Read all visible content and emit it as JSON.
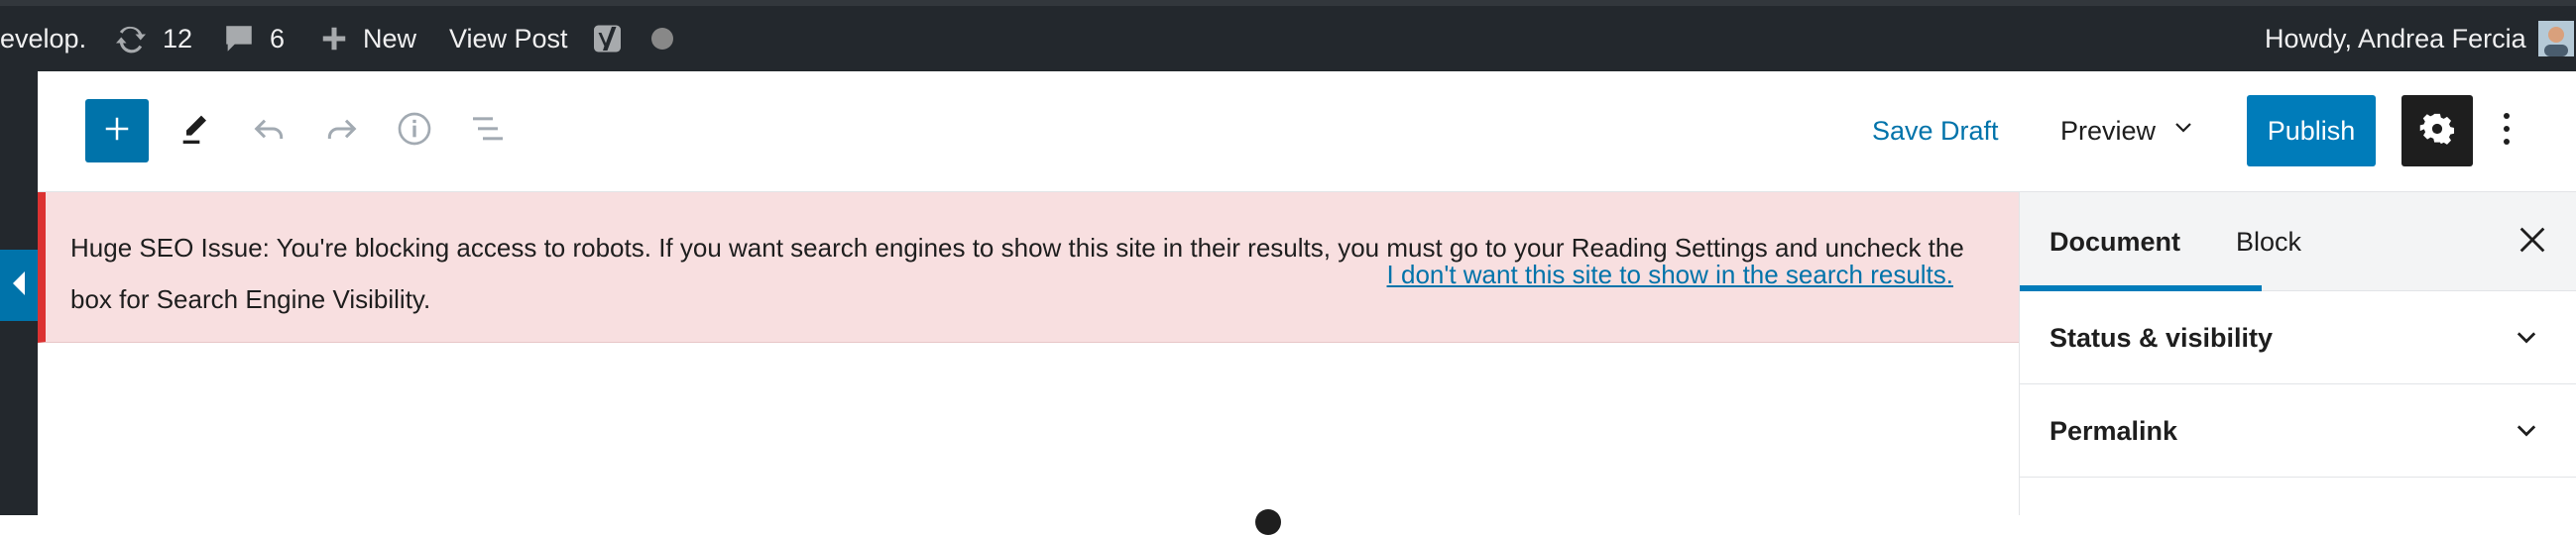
{
  "admin_bar": {
    "site_name": "evelop.",
    "updates_count": "12",
    "comments_count": "6",
    "new_label": "New",
    "view_post_label": "View Post",
    "greeting": "Howdy, Andrea Fercia",
    "icons": [
      "updates-icon",
      "comments-icon",
      "plus-icon",
      "yoast-icon",
      "status-dot-icon",
      "avatar"
    ]
  },
  "toolbar": {
    "save_draft_label": "Save Draft",
    "preview_label": "Preview",
    "publish_label": "Publish",
    "icons": [
      "plus-icon",
      "pencil-icon",
      "undo-icon",
      "redo-icon",
      "info-icon",
      "list-view-icon",
      "chevron-down-icon",
      "gear-icon",
      "more-vertical-icon"
    ]
  },
  "notice": {
    "message": "Huge SEO Issue: You're blocking access to robots. If you want search engines to show this site in their results, you must go to your Reading Settings and uncheck the box for Search Engine Visibility.",
    "link_label": "I don't want this site to show in the search results."
  },
  "sidebar": {
    "tabs": [
      {
        "label": "Document",
        "active": true
      },
      {
        "label": "Block",
        "active": false
      }
    ],
    "panels": [
      {
        "title": "Status & visibility"
      },
      {
        "title": "Permalink"
      }
    ]
  },
  "colors": {
    "admin_bar_bg": "#23282d",
    "accent": "#007cba",
    "notice_bg": "#f8dfe0",
    "notice_border": "#dc3232"
  }
}
